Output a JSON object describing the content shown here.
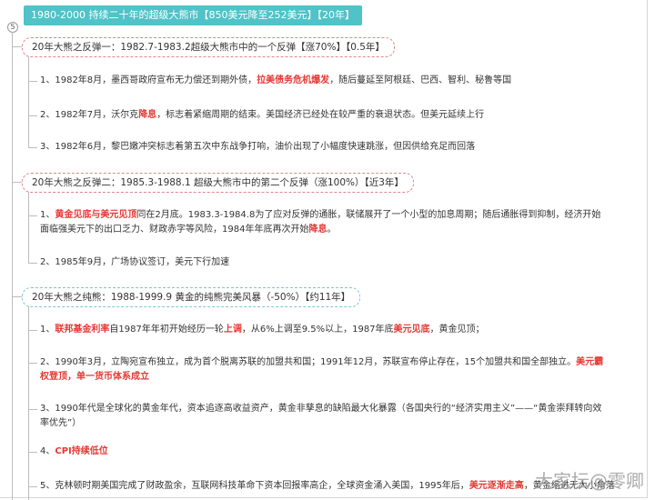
{
  "root": {
    "title": "1980-2000 持续二十年的超级大熊市【850美元降至252美元】【20年】",
    "collapse_count": "5"
  },
  "branches": [
    {
      "title": "20年大熊之反弹一：1982.7-1983.2超级大熊市中的一个反弹【涨70%】【0.5年】",
      "items": [
        {
          "segments": [
            {
              "t": "1、1982年8月，墨西哥政府宣布无力偿还到期外债，"
            },
            {
              "t": "拉美债务危机爆发",
              "hl": true
            },
            {
              "t": "，随后蔓延至阿根廷、巴西、智利、秘鲁等国"
            }
          ]
        },
        {
          "segments": [
            {
              "t": "2、1982年7月，沃尔克"
            },
            {
              "t": "降息",
              "hl": true
            },
            {
              "t": "，标志着紧缩周期的结束。美国经济已经处在较严重的衰退状态。但美元延续上行"
            }
          ]
        },
        {
          "segments": [
            {
              "t": "3、1982年6月，黎巴嫩冲突标志着第五次中东战争打响，油价出现了小幅度快速跳涨，但因供给充足而回落"
            }
          ]
        }
      ]
    },
    {
      "title": "20年大熊之反弹二：1985.3-1988.1 超级大熊市中的第二个反弹（涨100%）【近3年】",
      "items": [
        {
          "segments": [
            {
              "t": "1、"
            },
            {
              "t": "黄金见底与美元见顶",
              "hl": true
            },
            {
              "t": "同在2月底。1983.3-1984.8为了应对反弹的通胀，联储展开了一个小型的加息周期；随后通胀得到抑制，经济开始面临强美元下的出口乏力、财政赤字等风险，1984年年底再次开始"
            },
            {
              "t": "降息",
              "hl": true
            },
            {
              "t": "。"
            }
          ]
        },
        {
          "segments": [
            {
              "t": "2、1985年9月，广场协议签订，美元下行加速"
            }
          ]
        }
      ]
    },
    {
      "title": "20年大熊之纯熊：1988-1999.9 黄金的纯熊完美风暴（-50%）【约11年】",
      "items": [
        {
          "segments": [
            {
              "t": "1、"
            },
            {
              "t": "联邦基金利率",
              "hl": true
            },
            {
              "t": "自1987年年初开始经历一轮"
            },
            {
              "t": "上调",
              "hl": true
            },
            {
              "t": "，从6%上调至9.5%以上，1987年底"
            },
            {
              "t": "美元见底",
              "hl": true
            },
            {
              "t": "，黄金见顶；"
            }
          ]
        },
        {
          "segments": [
            {
              "t": "2、1990年3月，立陶宛宣布独立，成为首个脱离苏联的加盟共和国；1991年12月，苏联宣布停止存在，15个加盟共和国全部独立。"
            },
            {
              "t": "美元霸权登顶，单一货币体系成立",
              "hl": true
            }
          ]
        },
        {
          "segments": [
            {
              "t": "3、1990年代是全球化的黄金年代，资本追逐高收益资产，黄金非孳息的缺陷最大化暴露（各国央行的“经济实用主义”——“黄金崇拜转向效率优先”）"
            }
          ]
        },
        {
          "segments": [
            {
              "t": "4、"
            },
            {
              "t": "CPI持续低位",
              "hl": true
            }
          ]
        },
        {
          "segments": [
            {
              "t": "5、克林顿时期美国完成了财政盈余，互联网科技革命下资本回报率高企，全球资金涌入美国，1995年后，"
            },
            {
              "t": "美元逐渐走高",
              "hl": true
            },
            {
              "t": "，黄金缩进无大小角落"
            }
          ]
        }
      ]
    }
  ],
  "watermark": "大家坛@零卿"
}
